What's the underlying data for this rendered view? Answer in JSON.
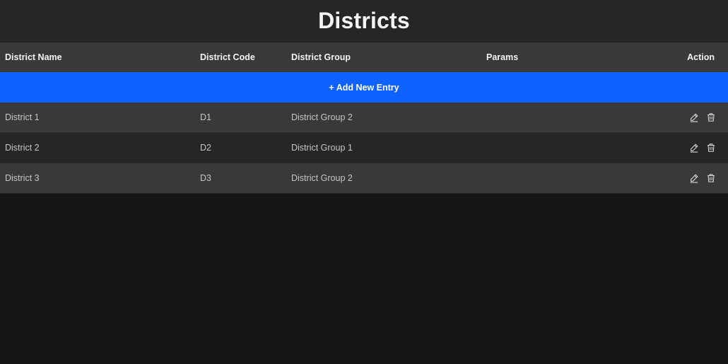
{
  "page": {
    "title": "Districts"
  },
  "table": {
    "headers": {
      "name": "District Name",
      "code": "District Code",
      "group": "District Group",
      "params": "Params",
      "action": "Action"
    },
    "add_label": "+ Add New Entry",
    "rows": [
      {
        "name": "District 1",
        "code": "D1",
        "group": "District Group 2",
        "params": ""
      },
      {
        "name": "District 2",
        "code": "D2",
        "group": "District Group 1",
        "params": ""
      },
      {
        "name": "District 3",
        "code": "D3",
        "group": "District Group 2",
        "params": ""
      }
    ]
  },
  "icons": {
    "edit": "pencil-icon",
    "delete": "trash-icon"
  },
  "colors": {
    "accent": "#0f62fe",
    "background": "#161616",
    "header": "#393939",
    "title_bar": "#262626"
  }
}
